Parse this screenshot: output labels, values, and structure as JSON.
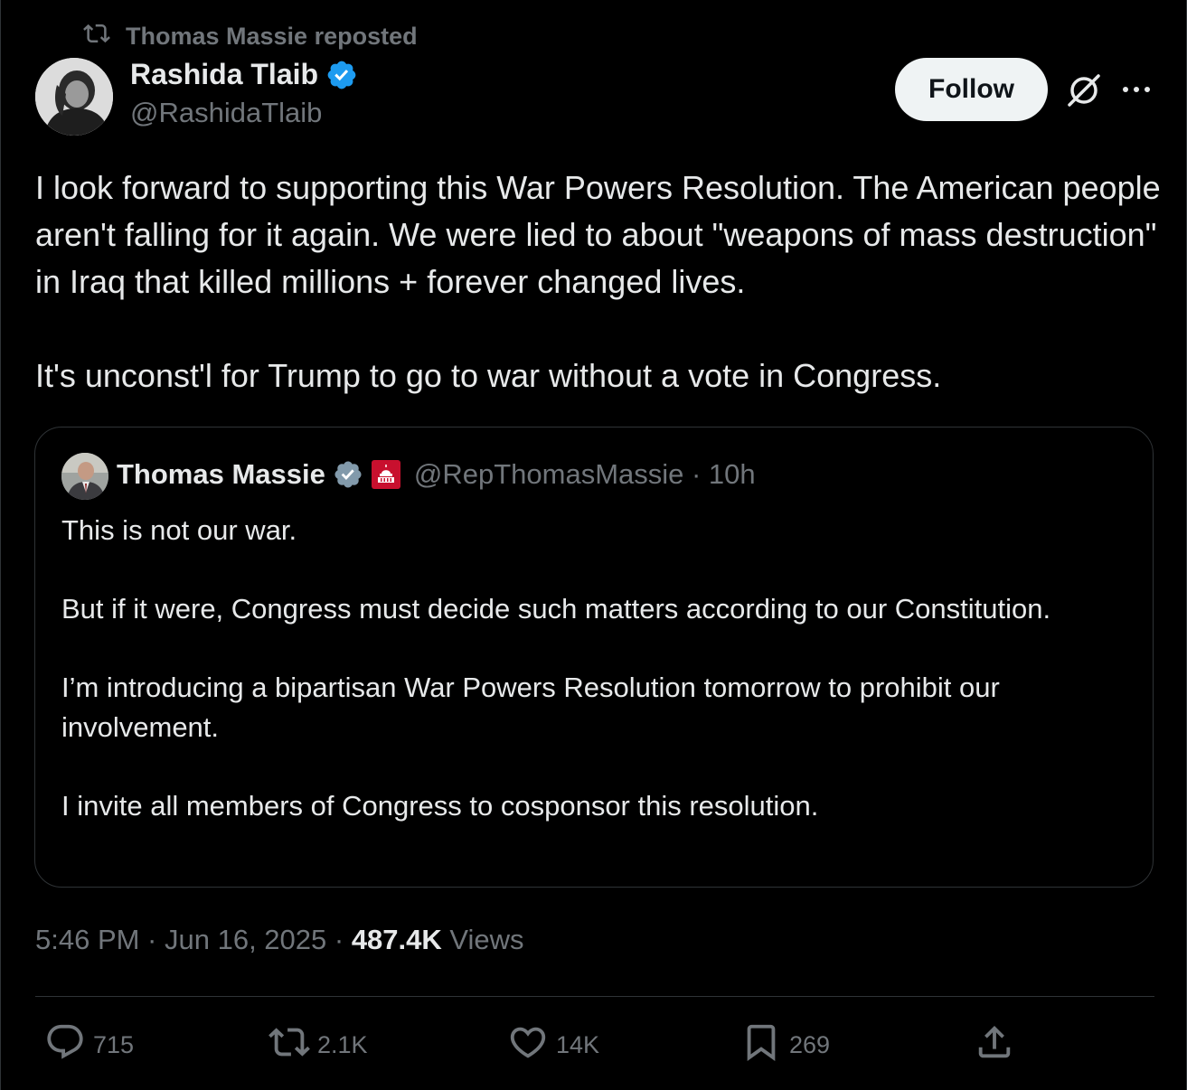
{
  "repost": {
    "text": "Thomas Massie reposted",
    "icon": "repost-icon"
  },
  "author": {
    "display_name": "Rashida Tlaib",
    "handle": "@RashidaTlaib",
    "verified_color": "#1d9bf0"
  },
  "header": {
    "follow_label": "Follow",
    "grok_icon": "grok-icon",
    "more_icon": "more-icon"
  },
  "tweet": {
    "paragraphs": [
      "I look forward to supporting this War Powers Resolution. The American people aren't falling for it again. We were lied to about \"weapons of mass destruction\" in Iraq that killed millions + forever changed lives.",
      "It's unconst'l for Trump to go to war without a vote in Congress."
    ]
  },
  "quote": {
    "display_name": "Thomas Massie",
    "handle_time": "@RepThomasMassie · 10h",
    "verified_color": "#829aab",
    "badge_color": "#c8102e",
    "paragraphs": [
      "This is not our war.",
      "But if it were, Congress must decide such matters according to our Constitution.",
      "I’m introducing a bipartisan War Powers Resolution tomorrow to prohibit our involvement.",
      "I invite all members of Congress to cosponsor this resolution."
    ]
  },
  "meta": {
    "timestamp": "5:46 PM · Jun 16, 2025 · ",
    "views_count": "487.4K",
    "views_label": " Views"
  },
  "actions": {
    "replies": "715",
    "reposts": "2.1K",
    "likes": "14K",
    "bookmarks": "269"
  },
  "colors": {
    "background": "#000000",
    "text": "#e7e9ea",
    "secondary": "#71767b",
    "border": "#2f3336"
  }
}
